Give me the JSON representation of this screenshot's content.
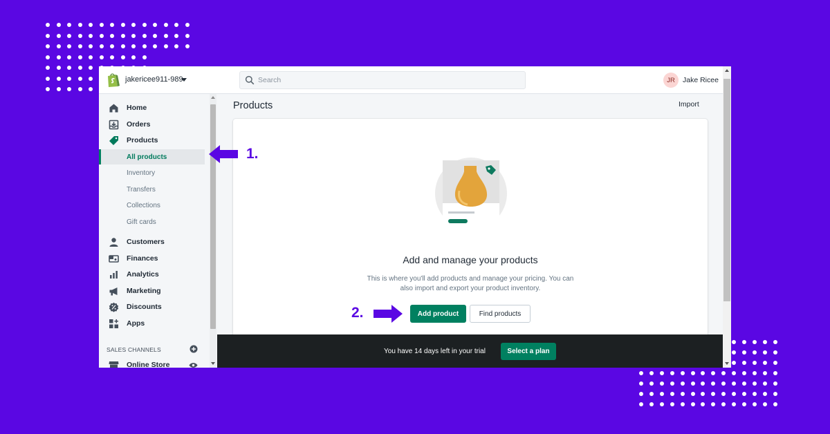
{
  "store": {
    "name": "jakericee911-989"
  },
  "search": {
    "placeholder": "Search"
  },
  "user": {
    "initials": "JR",
    "name": "Jake Ricee"
  },
  "sidebar": {
    "items": [
      {
        "label": "Home",
        "icon": "home-icon"
      },
      {
        "label": "Orders",
        "icon": "orders-icon"
      },
      {
        "label": "Products",
        "icon": "tag-icon"
      },
      {
        "label": "All products",
        "sub": true,
        "active": true
      },
      {
        "label": "Inventory",
        "sub": true
      },
      {
        "label": "Transfers",
        "sub": true
      },
      {
        "label": "Collections",
        "sub": true
      },
      {
        "label": "Gift cards",
        "sub": true
      },
      {
        "label": "Customers",
        "icon": "person-icon"
      },
      {
        "label": "Finances",
        "icon": "finances-icon"
      },
      {
        "label": "Analytics",
        "icon": "analytics-icon"
      },
      {
        "label": "Marketing",
        "icon": "megaphone-icon"
      },
      {
        "label": "Discounts",
        "icon": "discount-icon"
      },
      {
        "label": "Apps",
        "icon": "apps-icon"
      }
    ],
    "sales_channels": {
      "heading": "SALES CHANNELS",
      "online_store": "Online Store"
    }
  },
  "main": {
    "title": "Products",
    "import_label": "Import",
    "card": {
      "heading": "Add and manage your products",
      "description": "This is where you'll add products and manage your pricing. You can also import and export your product inventory.",
      "add_label": "Add product",
      "find_label": "Find products"
    }
  },
  "trial": {
    "message": "You have 14 days left in your trial",
    "button": "Select a plan"
  },
  "annotations": {
    "step1": "1.",
    "step2": "2."
  },
  "colors": {
    "background": "#5a07e3",
    "brand_green": "#008060",
    "annotation": "#5a07e3"
  }
}
